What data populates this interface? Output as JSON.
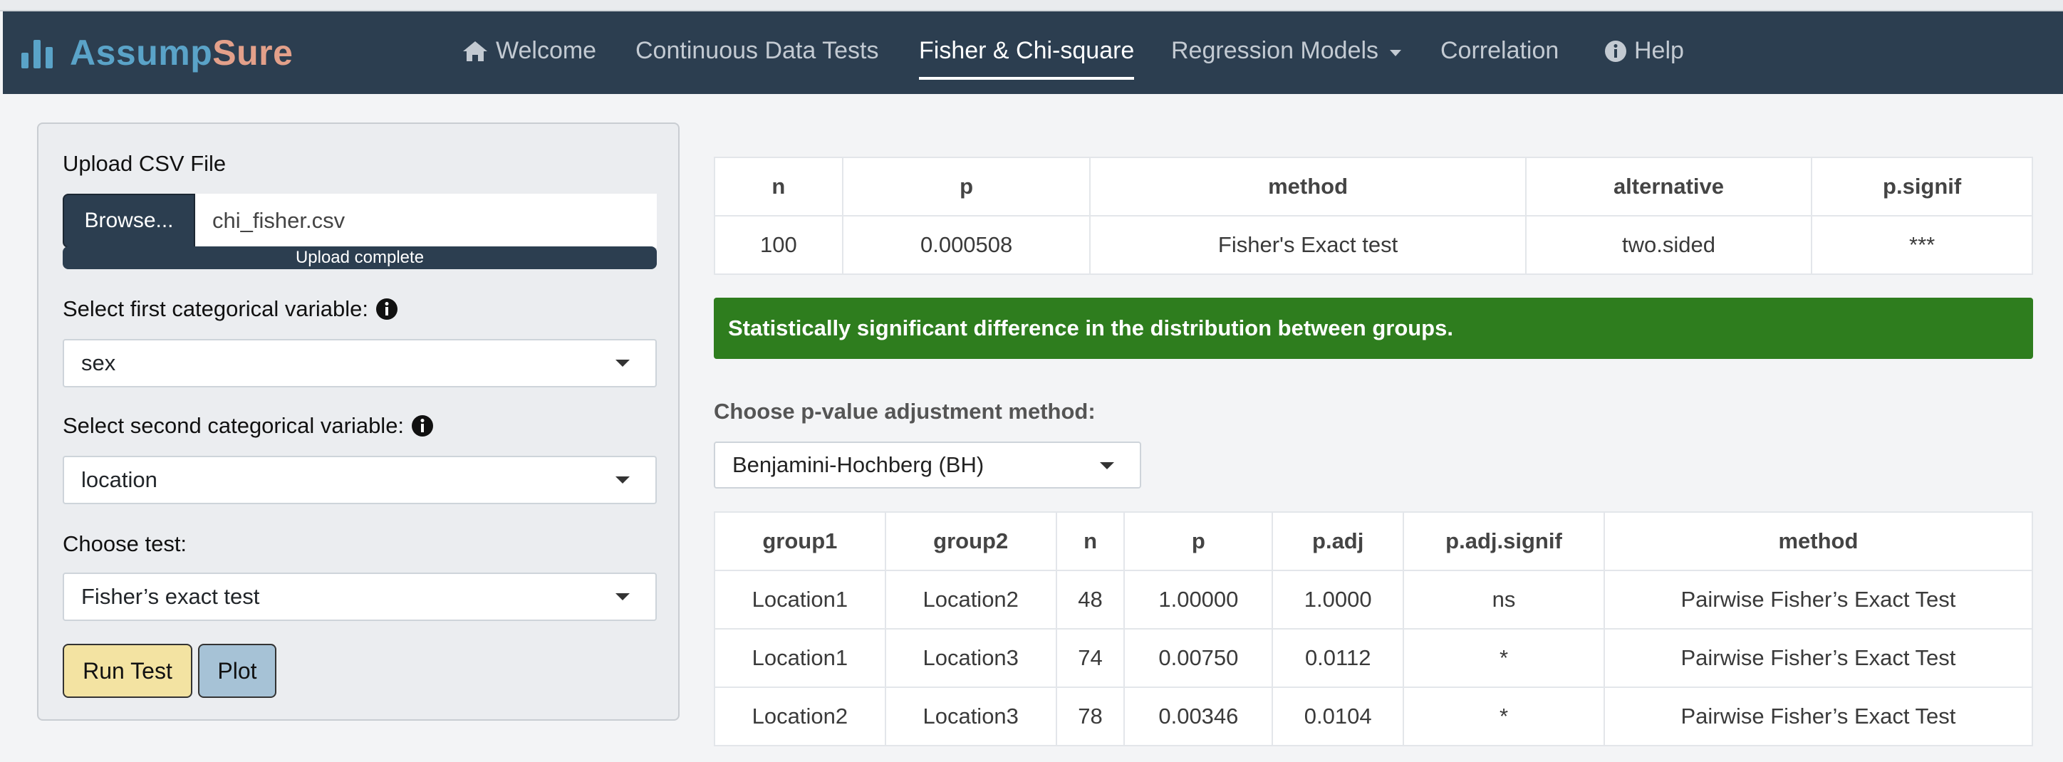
{
  "app": {
    "brand_part1": "Assump",
    "brand_part2": "Sure",
    "brand_color_1": "#5aa3c8",
    "brand_color_2": "#e3a08a",
    "navbar_color": "#2c3e50"
  },
  "nav": {
    "welcome": "Welcome",
    "continuous": "Continuous Data Tests",
    "fisher": "Fisher & Chi-square",
    "regression": "Regression Models",
    "correlation": "Correlation",
    "help": "Help",
    "active": "Fisher & Chi-square"
  },
  "sidebar": {
    "upload_label": "Upload CSV File",
    "browse_label": "Browse...",
    "file_name": "chi_fisher.csv",
    "upload_status": "Upload complete",
    "upload_progress": 1.0,
    "var1_label": "Select first categorical variable:",
    "var1_value": "sex",
    "var2_label": "Select second categorical variable:",
    "var2_value": "location",
    "test_label": "Choose test:",
    "test_value": "Fisher’s exact test",
    "run_label": "Run Test",
    "plot_label": "Plot"
  },
  "result_table": {
    "headers": [
      "n",
      "p",
      "method",
      "alternative",
      "p.signif"
    ],
    "row": [
      "100",
      "0.000508",
      "Fisher's Exact test",
      "two.sided",
      "***"
    ]
  },
  "alert": {
    "text": "Statistically significant difference in the distribution between groups.",
    "color": "#2e7d1e"
  },
  "adjust": {
    "label": "Choose p-value adjustment method:",
    "value": "Benjamini-Hochberg (BH)"
  },
  "pairwise_table": {
    "headers": [
      "group1",
      "group2",
      "n",
      "p",
      "p.adj",
      "p.adj.signif",
      "method"
    ],
    "rows": [
      [
        "Location1",
        "Location2",
        "48",
        "1.00000",
        "1.0000",
        "ns",
        "Pairwise Fisher’s Exact Test"
      ],
      [
        "Location1",
        "Location3",
        "74",
        "0.00750",
        "0.0112",
        "*",
        "Pairwise Fisher’s Exact Test"
      ],
      [
        "Location2",
        "Location3",
        "78",
        "0.00346",
        "0.0104",
        "*",
        "Pairwise Fisher’s Exact Test"
      ]
    ]
  }
}
